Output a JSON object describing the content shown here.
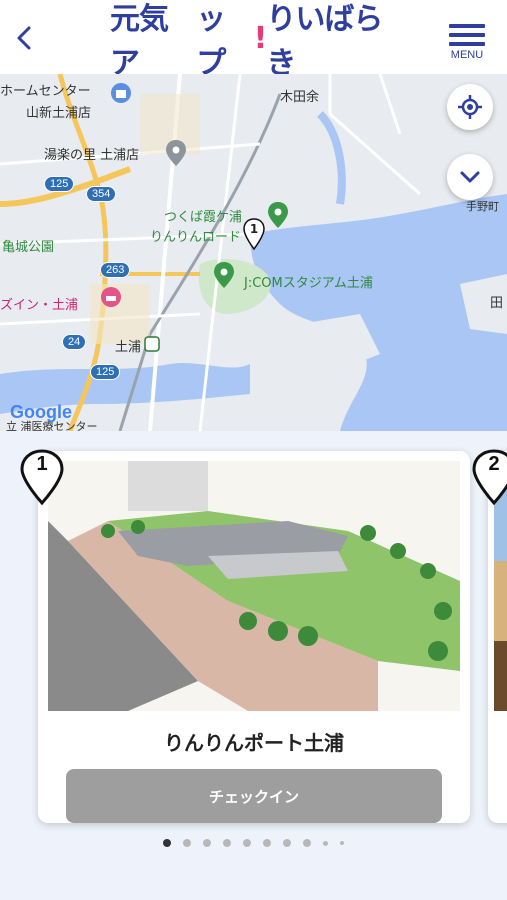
{
  "header": {
    "logo_part1": "元気ア",
    "logo_part2": "ップ",
    "logo_accent": "!",
    "logo_part3": "りいばらき",
    "menu_label": "MENU"
  },
  "map": {
    "labels": {
      "home_center": "ホームセンター",
      "yamashin": "山新土浦店",
      "kidayo": "木田余",
      "yuraku": "湯楽の里 土浦店",
      "tsukuba_line1": "つくば霞ケ浦",
      "tsukuba_line2": "りんりんロード",
      "jcom": "J:COMスタジアム土浦",
      "kijo_park": "亀城公園",
      "inn": "ズイン・土浦",
      "tsuchiura": "土浦",
      "teno": "手野町",
      "den": "田",
      "bottom_left": "立 浦医療センター"
    },
    "routes": [
      "125",
      "354",
      "263",
      "24",
      "125"
    ],
    "google": "Google",
    "pin_number": "1"
  },
  "cards": [
    {
      "number": "1",
      "title": "りんりんポート土浦",
      "button": "チェックイン"
    },
    {
      "number": "2"
    }
  ],
  "pagination": {
    "total": 10,
    "active": 0
  },
  "colors": {
    "brand": "#2e3f9f",
    "accent": "#e63a7a",
    "button_disabled": "#9e9e9e",
    "water": "#a9c6f5"
  }
}
